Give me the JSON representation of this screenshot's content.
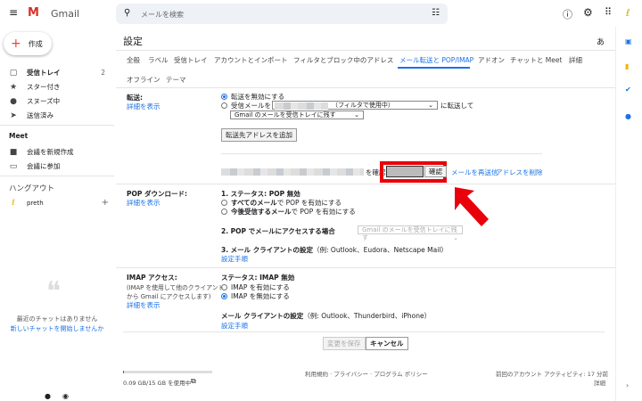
{
  "header": {
    "app": "Gmail",
    "search_placeholder": "メールを検索"
  },
  "sidebar": {
    "compose": "作成",
    "items": [
      {
        "label": "受信トレイ",
        "count": "2",
        "icon": "inbox-icon"
      },
      {
        "label": "スター付き",
        "icon": "star-icon"
      },
      {
        "label": "スヌーズ中",
        "icon": "clock-icon"
      },
      {
        "label": "送信済み",
        "icon": "send-icon"
      }
    ],
    "meet_title": "Meet",
    "meet_items": [
      "会議を新規作成",
      "会議に参加"
    ],
    "hangouts_title": "ハングアウト",
    "user": "preth",
    "chat_empty": "最近のチャットはありません",
    "chat_new": "新しいチャットを開始しませんか"
  },
  "settings": {
    "title": "設定",
    "lang": "あ",
    "tabs": [
      "全般",
      "ラベル",
      "受信トレイ",
      "アカウントとインポート",
      "フィルタとブロック中のアドレス",
      "メール転送と POP/IMAP",
      "アドオン",
      "チャットと Meet",
      "詳細",
      "オフライン",
      "テーマ"
    ],
    "active_tab": "メール転送と POP/IMAP",
    "forward": {
      "label": "転送:",
      "details": "詳細を表示",
      "opt1": "転送を無効にする",
      "opt2_pre": "受信メールを",
      "opt2_sel": "（フィルタで使用中）",
      "opt2_post": "に転送して",
      "keep_sel": "Gmail のメールを受信トレイに残す",
      "add_btn": "転送先アドレスを追加",
      "confirm_pre": "を確認",
      "confirm_btn": "確認",
      "resend": "メールを再送信",
      "delete": "アドレスを削除"
    },
    "pop": {
      "label": "POP ダウンロード:",
      "details": "詳細を表示",
      "status": "1. ステータス: POP 無効",
      "opt1_b": "すべてのメール",
      "opt1": "で POP を有効にする",
      "opt2_b": "今後受信するメール",
      "opt2": "で POP を有効にする",
      "access": "2. POP でメールにアクセスする場合",
      "access_sel": "Gmail のメールを受信トレイに残す",
      "client": "3. メール クライアントの設定",
      "client_ex": "（例: Outlook、Eudora、Netscape Mail）",
      "setup": "設定手順"
    },
    "imap": {
      "label": "IMAP アクセス:",
      "desc1": "(IMAP を使用して他のクライアント",
      "desc2": "から Gmail にアクセスします)",
      "details": "詳細を表示",
      "status": "ステータス: IMAP 無効",
      "opt1": "IMAP を有効にする",
      "opt2": "IMAP を無効にする",
      "client": "メール クライアントの設定",
      "client_ex": "（例: Outlook、Thunderbird、iPhone）",
      "setup": "設定手順"
    },
    "save": "変更を保存",
    "cancel": "キャンセル"
  },
  "footer": {
    "storage": "0.09 GB/15 GB を使用中",
    "storage_fraction": 0.006,
    "links": "利用規約 · プライバシー · プログラム ポリシー",
    "activity": "前回のアカウント アクティビティ: 17 分前",
    "details": "詳細"
  },
  "colors": {
    "accent": "#1a73e8",
    "highlight": "#e8000b"
  }
}
